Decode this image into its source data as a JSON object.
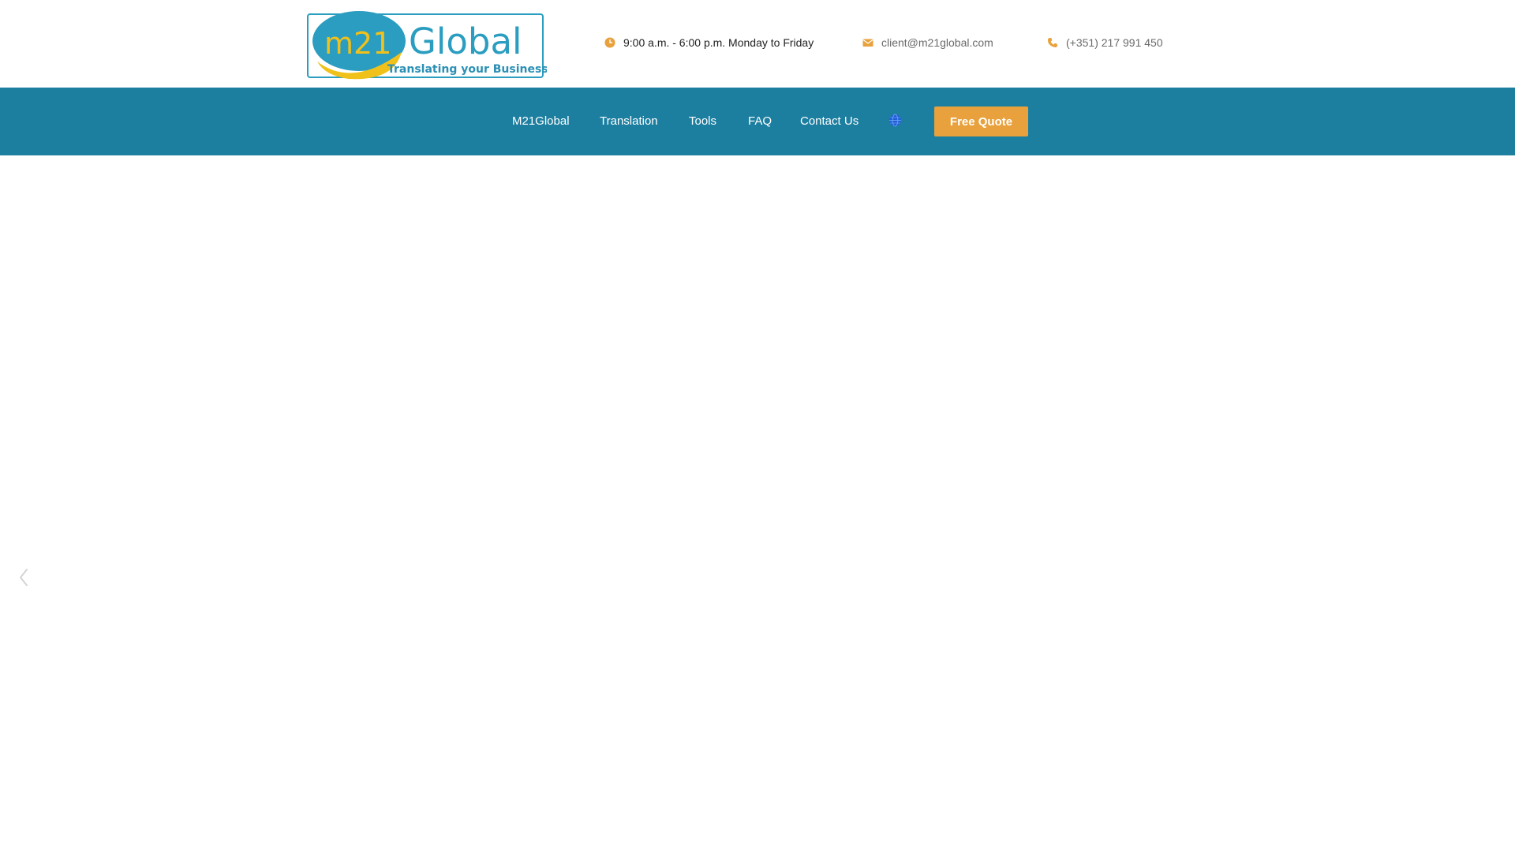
{
  "header": {
    "logo": {
      "brand_mark": "m21",
      "brand_word": "Global",
      "tagline": "Translating your Business",
      "colors": {
        "blue": "#2a9dc0",
        "yellow": "#f0c11a",
        "tagline": "#2a8fb5"
      }
    },
    "hours": {
      "icon": "clock-icon",
      "text": "9:00 a.m. - 6:00 p.m. Monday to Friday"
    },
    "email": {
      "icon": "envelope-icon",
      "text": "client@m21global.com"
    },
    "phone": {
      "icon": "phone-icon",
      "text": "(+351) 217 991 450"
    },
    "icon_color": "#e8a13c"
  },
  "nav": {
    "background": "#1d7fa0",
    "items": [
      {
        "label": "M21Global"
      },
      {
        "label": "Translation"
      },
      {
        "label": "Tools"
      },
      {
        "label": "FAQ"
      },
      {
        "label": "Contact Us"
      }
    ],
    "language_icon": "globe-icon",
    "cta": {
      "label": "Free Quote",
      "color": "#e8a13c"
    }
  },
  "hero": {
    "prev_icon": "chevron-left-icon"
  }
}
